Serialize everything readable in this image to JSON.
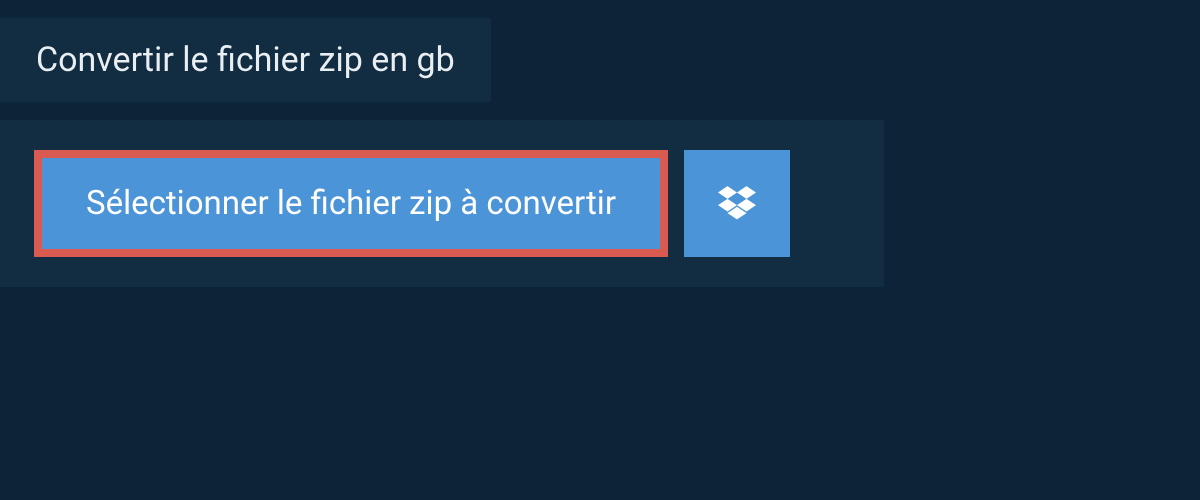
{
  "header": {
    "title": "Convertir le fichier zip en gb"
  },
  "actions": {
    "select_file_label": "Sélectionner le fichier zip à convertir"
  },
  "colors": {
    "background": "#0c2338",
    "panel": "#122c41",
    "button": "#4c94d8",
    "highlight_border": "#d95a50",
    "text_light": "#ffffff"
  },
  "icons": {
    "dropbox": "dropbox-icon"
  }
}
